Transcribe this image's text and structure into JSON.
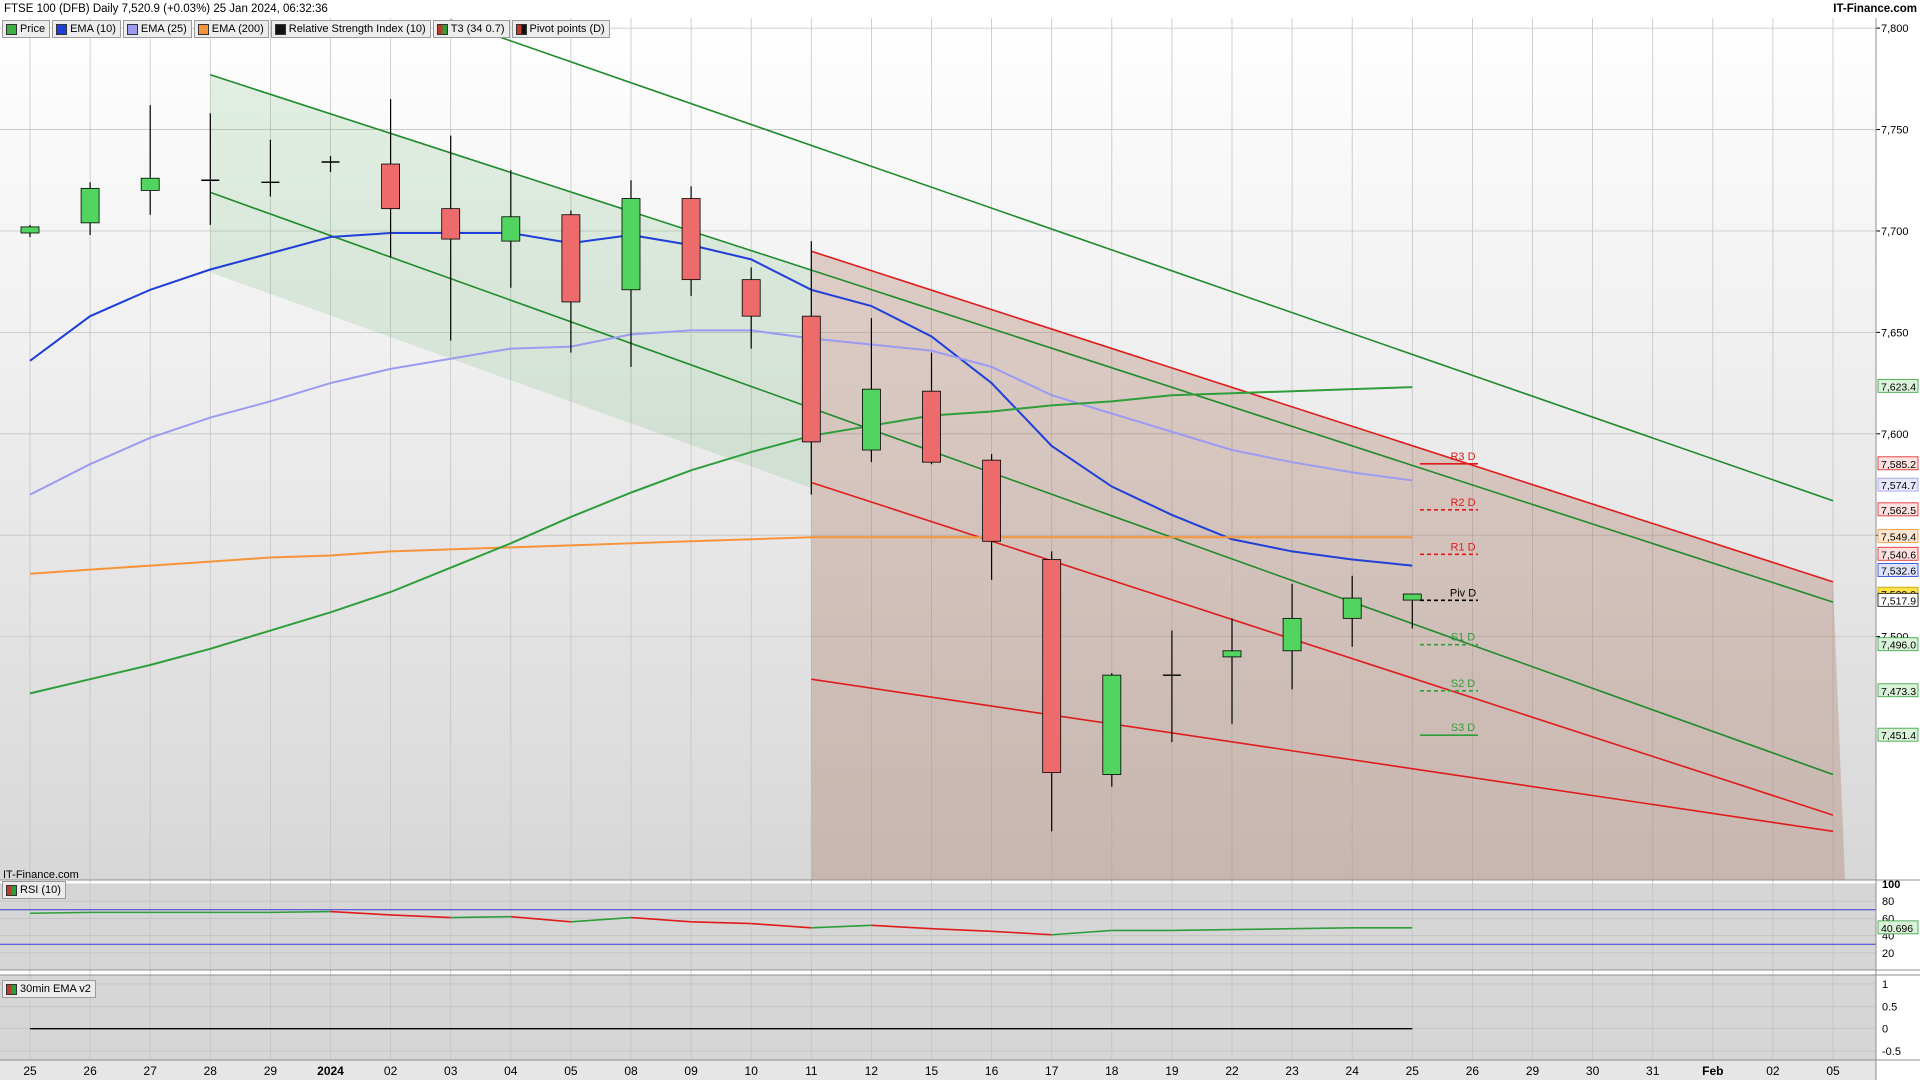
{
  "header": {
    "title": "FTSE 100 (DFB) Daily 7,520.9 (+0.03%) 25 Jan 2024, 06:32:36",
    "brand": "IT-Finance.com",
    "watermark": "IT-Finance.com"
  },
  "legend": [
    {
      "label": "Price",
      "color": "#3cb043"
    },
    {
      "label": "EMA (10)",
      "color": "#1f3fd8"
    },
    {
      "label": "EMA (25)",
      "color": "#9b9bf2"
    },
    {
      "label": "EMA (200)",
      "color": "#f7943a"
    },
    {
      "label": "Relative Strength Index (10)",
      "color": "#111111"
    },
    {
      "label": "T3 (34 0.7)",
      "color": "#c0392b"
    },
    {
      "label": "Pivot points (D)",
      "color": "#111111"
    }
  ],
  "rsi_panel": {
    "label": "RSI (10)",
    "value_label": "40.696",
    "ticks": [
      "100",
      "80",
      "60",
      "40",
      "20"
    ]
  },
  "ema_panel": {
    "label": "30min EMA v2",
    "ticks": [
      "1",
      "0.5",
      "0",
      "-0.5"
    ]
  },
  "colors": {
    "up": "#52d460",
    "down": "#ee6b6b",
    "ema10": "#1f3fd8",
    "ema25": "#9b9bf2",
    "ema200": "#f7943a",
    "t3": "#2e9e3a",
    "channel_green": "#1f8a2a",
    "channel_red": "#e01b1b"
  },
  "chart_data": [
    {
      "type": "candlestick",
      "title": "FTSE 100 (DFB) Daily",
      "x_labels": [
        "25",
        "26",
        "27",
        "28",
        "29",
        "2024",
        "02",
        "03",
        "04",
        "05",
        "08",
        "09",
        "10",
        "11",
        "12",
        "15",
        "16",
        "17",
        "18",
        "19",
        "22",
        "23",
        "24",
        "25",
        "26",
        "29",
        "30",
        "31",
        "Feb",
        "02",
        "05"
      ],
      "ylim": [
        7380,
        7805
      ],
      "y_ticks": [
        7500,
        7550,
        7600,
        7650,
        7700,
        7750,
        7800
      ],
      "y_tick_labels": [
        "7,500",
        "7,550",
        "7,600",
        "7,650",
        "7,700",
        "7,750",
        "7,800"
      ],
      "candles": [
        {
          "o": 7699,
          "h": 7703,
          "l": 7697,
          "c": 7702
        },
        {
          "o": 7704,
          "h": 7724,
          "l": 7698,
          "c": 7721
        },
        {
          "o": 7720,
          "h": 7762,
          "l": 7708,
          "c": 7726
        },
        {
          "o": 7725,
          "h": 7758,
          "l": 7703,
          "c": 7725
        },
        {
          "o": 7724,
          "h": 7745,
          "l": 7717,
          "c": 7724
        },
        {
          "o": 7734,
          "h": 7737,
          "l": 7729,
          "c": 7734
        },
        {
          "o": 7733,
          "h": 7765,
          "l": 7687,
          "c": 7711
        },
        {
          "o": 7711,
          "h": 7747,
          "l": 7646,
          "c": 7696
        },
        {
          "o": 7695,
          "h": 7730,
          "l": 7672,
          "c": 7707
        },
        {
          "o": 7708,
          "h": 7710,
          "l": 7640,
          "c": 7665
        },
        {
          "o": 7671,
          "h": 7725,
          "l": 7633,
          "c": 7716
        },
        {
          "o": 7716,
          "h": 7722,
          "l": 7668,
          "c": 7676
        },
        {
          "o": 7676,
          "h": 7682,
          "l": 7642,
          "c": 7658
        },
        {
          "o": 7658,
          "h": 7695,
          "l": 7570,
          "c": 7596
        },
        {
          "o": 7592,
          "h": 7657,
          "l": 7586,
          "c": 7622
        },
        {
          "o": 7621,
          "h": 7640,
          "l": 7585,
          "c": 7586
        },
        {
          "o": 7587,
          "h": 7590,
          "l": 7528,
          "c": 7547
        },
        {
          "o": 7538,
          "h": 7542,
          "l": 7404,
          "c": 7433
        },
        {
          "o": 7432,
          "h": 7482,
          "l": 7426,
          "c": 7481
        },
        {
          "o": 7481,
          "h": 7503,
          "l": 7448,
          "c": 7481
        },
        {
          "o": 7490,
          "h": 7509,
          "l": 7457,
          "c": 7493
        },
        {
          "o": 7493,
          "h": 7526,
          "l": 7474,
          "c": 7509
        },
        {
          "o": 7509,
          "h": 7530,
          "l": 7495,
          "c": 7519
        },
        {
          "o": 7518,
          "h": 7521,
          "l": 7504,
          "c": 7521
        }
      ],
      "series": [
        {
          "name": "EMA (10)",
          "values": [
            7636,
            7658,
            7671,
            7681,
            7689,
            7697,
            7699,
            7699,
            7699,
            7694,
            7698,
            7693,
            7686,
            7671,
            7663,
            7648,
            7625,
            7594,
            7574,
            7560,
            7548,
            7542,
            7538,
            7535
          ]
        },
        {
          "name": "EMA (25)",
          "values": [
            7570,
            7585,
            7598,
            7608,
            7616,
            7625,
            7632,
            7637,
            7642,
            7643,
            7649,
            7651,
            7651,
            7647,
            7644,
            7641,
            7633,
            7619,
            7610,
            7601,
            7592,
            7586,
            7581,
            7577
          ]
        },
        {
          "name": "EMA (200)",
          "values": [
            7531,
            7533,
            7535,
            7537,
            7539,
            7540,
            7542,
            7543,
            7544,
            7545,
            7546,
            7547,
            7548,
            7549,
            7549,
            7549,
            7549,
            7549,
            7549,
            7549,
            7549,
            7549,
            7549,
            7549
          ]
        },
        {
          "name": "T3 (34 0.7)",
          "values": [
            7472,
            7479,
            7486,
            7494,
            7503,
            7512,
            7522,
            7534,
            7546,
            7559,
            7571,
            7582,
            7591,
            7599,
            7604,
            7609,
            7611,
            7614,
            7616,
            7619,
            7620,
            7621,
            7622,
            7623
          ]
        }
      ],
      "pivots": [
        {
          "label": "R3 D",
          "value": 7585.2
        },
        {
          "label": "R2 D",
          "value": 7562.5
        },
        {
          "label": "R1 D",
          "value": 7540.6
        },
        {
          "label": "Piv D",
          "value": 7517.9
        },
        {
          "label": "S1 D",
          "value": 7496.0
        },
        {
          "label": "S2 D",
          "value": 7473.3
        },
        {
          "label": "S3 D",
          "value": 7451.4
        }
      ],
      "price_labels": [
        {
          "label": "7,623.4",
          "value": 7623.4
        },
        {
          "label": "7,585.2",
          "value": 7585.2
        },
        {
          "label": "7,574.7",
          "value": 7574.7
        },
        {
          "label": "7,562.5",
          "value": 7562.5
        },
        {
          "label": "7,549.4",
          "value": 7549.4
        },
        {
          "label": "7,540.6",
          "value": 7540.6
        },
        {
          "label": "7,532.6",
          "value": 7532.6
        },
        {
          "label": "7,520.9",
          "value": 7520.9
        },
        {
          "label": "7,517.9",
          "value": 7517.9
        },
        {
          "label": "7,496.0",
          "value": 7496.0
        },
        {
          "label": "7,473.3",
          "value": 7473.3
        },
        {
          "label": "7,451.4",
          "value": 7451.4
        }
      ],
      "channels": [
        {
          "name": "green",
          "lines": [
            [
              [
                3,
                7777
              ],
              [
                30,
                7517
              ]
            ],
            [
              [
                3,
                7719
              ],
              [
                30,
                7432
              ]
            ]
          ],
          "extra": [
            [
              [
                7,
                7804
              ],
              [
                30,
                7567
              ]
            ]
          ]
        },
        {
          "name": "red",
          "lines": [
            [
              [
                13,
                7690
              ],
              [
                30,
                7527
              ]
            ],
            [
              [
                13,
                7576
              ],
              [
                30,
                7412
              ]
            ]
          ],
          "extra": [
            [
              [
                13,
                7479
              ],
              [
                30,
                7404
              ]
            ]
          ]
        }
      ]
    },
    {
      "type": "line",
      "title": "RSI (10)",
      "ylim": [
        0,
        100
      ],
      "y_ticks": [
        100,
        80,
        60,
        40,
        20
      ],
      "values": [
        66,
        67,
        67,
        67,
        67,
        68,
        64,
        61,
        62,
        56,
        61,
        56,
        54,
        49,
        52,
        48,
        45,
        41,
        46,
        46,
        47,
        48,
        49,
        49
      ]
    },
    {
      "type": "line",
      "title": "30min EMA v2",
      "ylim": [
        -0.7,
        1.2
      ],
      "y_ticks": [
        1,
        0.5,
        0,
        -0.5
      ],
      "values": [
        0,
        0,
        0,
        0,
        0,
        0,
        0,
        0,
        0,
        0,
        0,
        0,
        0,
        0,
        0,
        0,
        0,
        0,
        0,
        0,
        0,
        0,
        0,
        0
      ]
    }
  ]
}
